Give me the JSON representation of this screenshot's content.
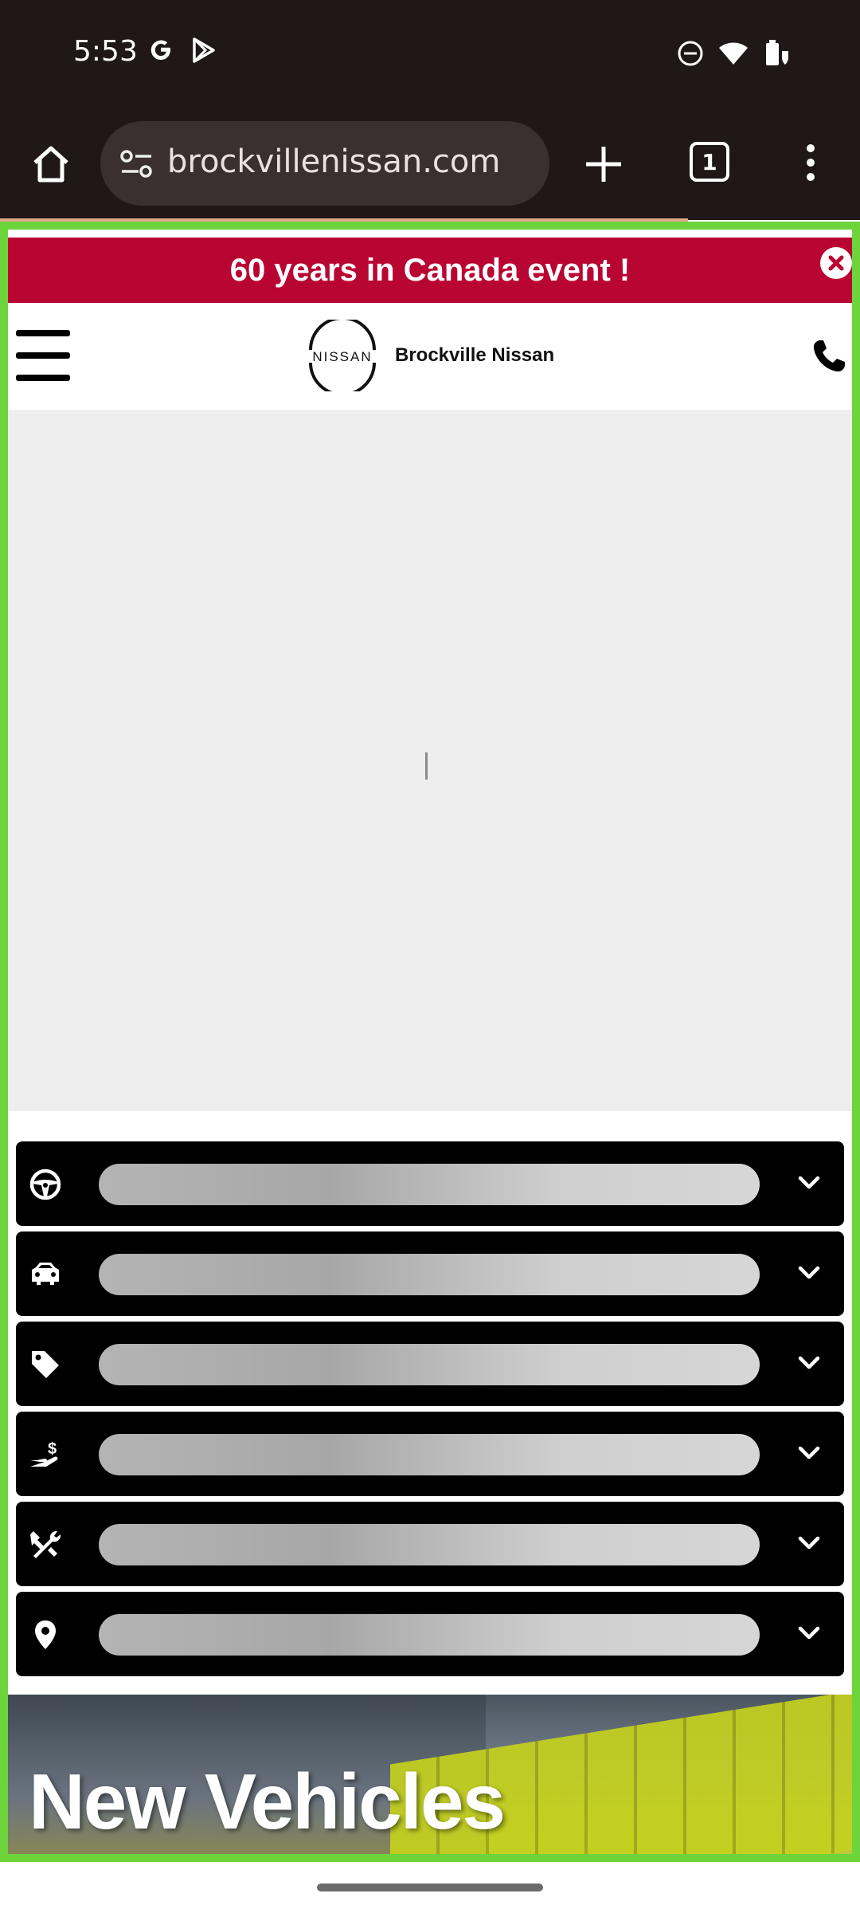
{
  "status_bar": {
    "time": "5:53",
    "left_icons": [
      "google-g-icon",
      "play-store-icon"
    ],
    "right_icons": [
      "do-not-disturb-icon",
      "wifi-icon",
      "battery-saver-icon"
    ]
  },
  "browser": {
    "url": "brockvillenissan.com",
    "tab_count": "1",
    "icons": [
      "home-icon",
      "site-settings-icon",
      "new-tab-icon",
      "tab-switcher-icon",
      "overflow-menu-icon"
    ],
    "load_progress": 0.8
  },
  "banner": {
    "text": "60 years in Canada event !",
    "background": "#b90532"
  },
  "header": {
    "logo_mark": "NISSAN",
    "dealer_name": "Brockville Nissan",
    "icons": [
      "hamburger-menu-icon",
      "nissan-logo",
      "phone-icon"
    ]
  },
  "nav": {
    "items": [
      {
        "icon": "steering-wheel-icon",
        "label": ""
      },
      {
        "icon": "car-icon",
        "label": ""
      },
      {
        "icon": "price-tag-icon",
        "label": ""
      },
      {
        "icon": "finance-hand-icon",
        "label": ""
      },
      {
        "icon": "tools-icon",
        "label": ""
      },
      {
        "icon": "location-pin-icon",
        "label": ""
      }
    ]
  },
  "vehicles": {
    "title": "New Vehicles"
  },
  "colors": {
    "frame_highlight": "#6dd43c",
    "browser_chrome": "#201718"
  }
}
